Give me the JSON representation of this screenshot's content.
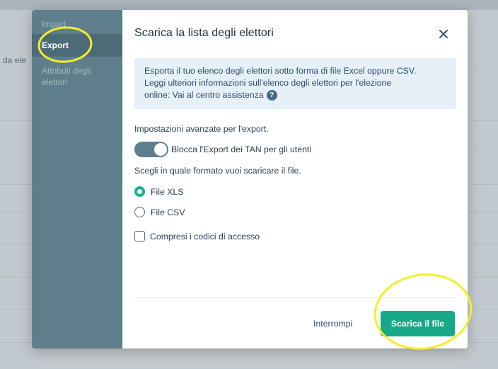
{
  "background": {
    "column_text": "da ele"
  },
  "sidebar": {
    "items": [
      {
        "label": "Import"
      },
      {
        "label": "Export"
      },
      {
        "label": "Attributi degli elettori"
      }
    ]
  },
  "modal": {
    "title": "Scarica la lista degli elettori",
    "info": {
      "text_line1": "Esporta il tuo elenco degli elettori sotto forma di file Excel oppure CSV.",
      "text_line2": "Leggi ulteriori informazioni sull'elenco degli elettori per l'elezione",
      "text_line3_prefix": "online: ",
      "link_label": "Vai al centro assistenza",
      "help_glyph": "?"
    },
    "advanced_label": "Impostazioni avanzate per l'export.",
    "toggle_label": "Blocca l'Export dei TAN per gli utenti",
    "toggle_on": true,
    "format_label": "Scegli in quale formato vuoi scaricare il file.",
    "formats": [
      {
        "label": "File XLS",
        "checked": true
      },
      {
        "label": "File CSV",
        "checked": false
      }
    ],
    "checkbox_label": "Compresi i codici di accesso",
    "cancel_label": "Interrompi",
    "download_label": "Scarica il file"
  },
  "colors": {
    "accent": "#17a987",
    "sidebar": "#5e7e8b",
    "annotation": "#f5ee2a"
  }
}
